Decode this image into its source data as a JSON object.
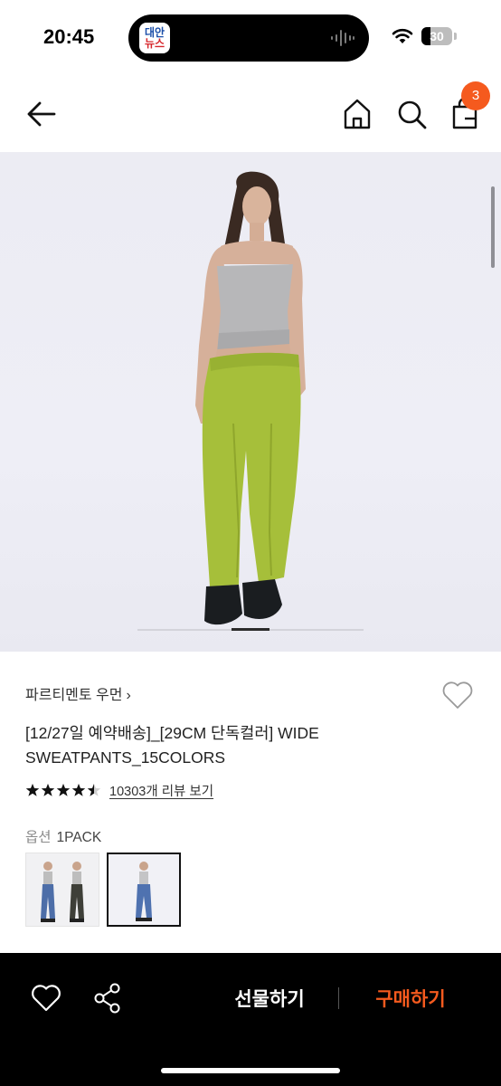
{
  "status_bar": {
    "time": "20:45",
    "island_app": {
      "name": "news-app-logo",
      "line1": "대안",
      "line2": "뉴스"
    },
    "battery_level": "30",
    "battery_fraction": 0.3
  },
  "header": {
    "back_icon": "arrow-left-icon",
    "home_icon": "home-icon",
    "search_icon": "search-icon",
    "cart_icon": "shopping-bag-icon",
    "cart_count": "3",
    "badge_color": "#f55a1e"
  },
  "product": {
    "brand": "파르티멘토 우먼",
    "brand_chevron": "›",
    "title": "[12/27일 예약배송]_[29CM 단독컬러] WIDE SWEATPANTS_15COLORS",
    "rating": 4.5,
    "review_link": "10303개 리뷰 보기",
    "option_label": "옵션",
    "option_value": "1PACK",
    "image_carousel": {
      "current": 2,
      "total": 3
    },
    "thumbnails": [
      {
        "name": "thumbnail-two-models",
        "selected": false
      },
      {
        "name": "thumbnail-single-model",
        "selected": true
      }
    ]
  },
  "bottom_bar": {
    "wishlist_icon": "heart-icon",
    "share_icon": "share-icon",
    "gift_label": "선물하기",
    "buy_label": "구매하기",
    "buy_color": "#f55a1e"
  }
}
